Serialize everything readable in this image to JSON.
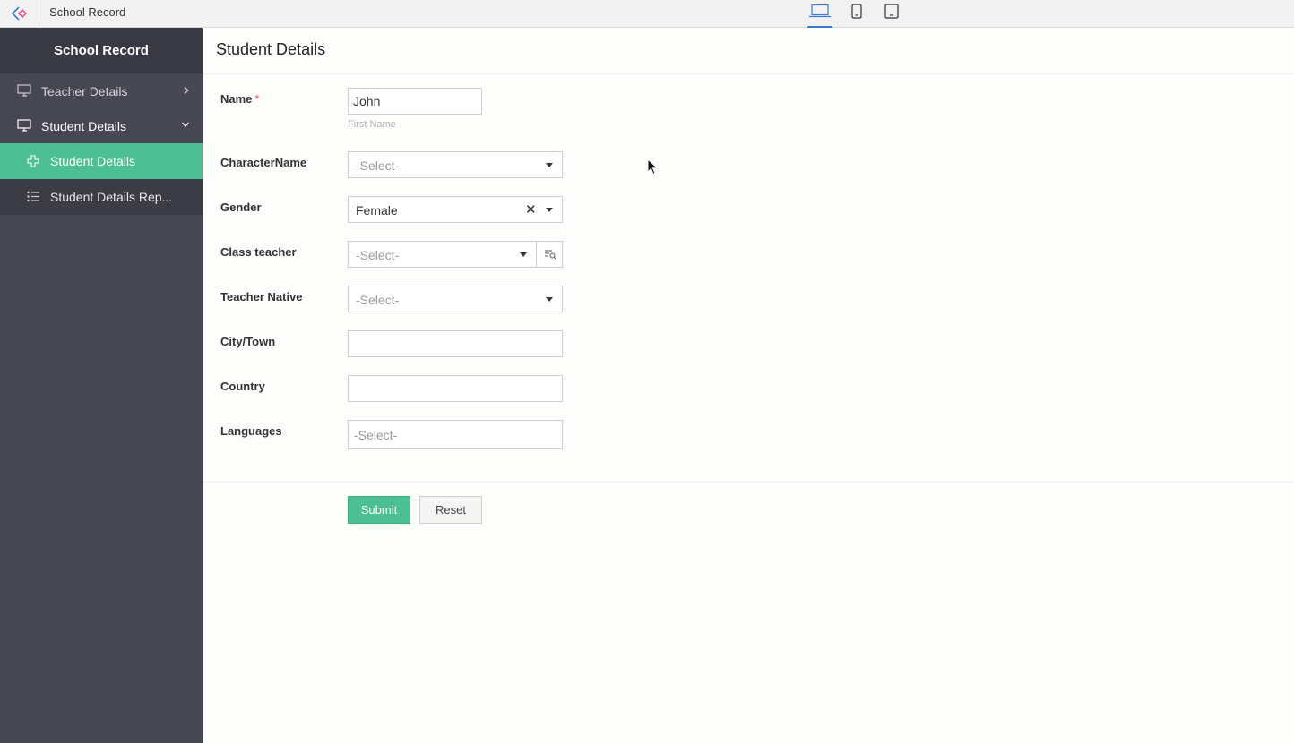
{
  "topbar": {
    "app_title": "School Record",
    "devices": [
      "laptop-icon",
      "mobile-icon",
      "tablet-icon"
    ],
    "active_device": "laptop"
  },
  "sidebar": {
    "title": "School Record",
    "items": [
      {
        "label": "Teacher Details",
        "icon": "monitor-icon",
        "state": "collapsed"
      },
      {
        "label": "Student Details",
        "icon": "monitor-icon",
        "state": "expanded",
        "children": [
          {
            "label": "Student Details",
            "icon": "plus-icon",
            "active": true
          },
          {
            "label": "Student Details Rep...",
            "icon": "list-icon",
            "active": false
          }
        ]
      }
    ]
  },
  "form": {
    "title": "Student Details",
    "fields": {
      "name": {
        "label": "Name",
        "required": "*",
        "value": "John",
        "hint": "First Name"
      },
      "character_name": {
        "label": "CharacterName",
        "placeholder": "-Select-"
      },
      "gender": {
        "label": "Gender",
        "value": "Female"
      },
      "class_teacher": {
        "label": "Class teacher",
        "placeholder": "-Select-"
      },
      "teacher_native": {
        "label": "Teacher Native",
        "placeholder": "-Select-"
      },
      "city": {
        "label": "City/Town",
        "value": ""
      },
      "country": {
        "label": "Country",
        "value": ""
      },
      "languages": {
        "label": "Languages",
        "placeholder": "-Select-"
      }
    },
    "buttons": {
      "submit": "Submit",
      "reset": "Reset"
    }
  },
  "colors": {
    "sidebar_bg": "#474753",
    "sidebar_header_bg": "#393943",
    "accent": "#4cbf95",
    "active_device": "#3a7bd5",
    "required": "#e24b4b"
  }
}
